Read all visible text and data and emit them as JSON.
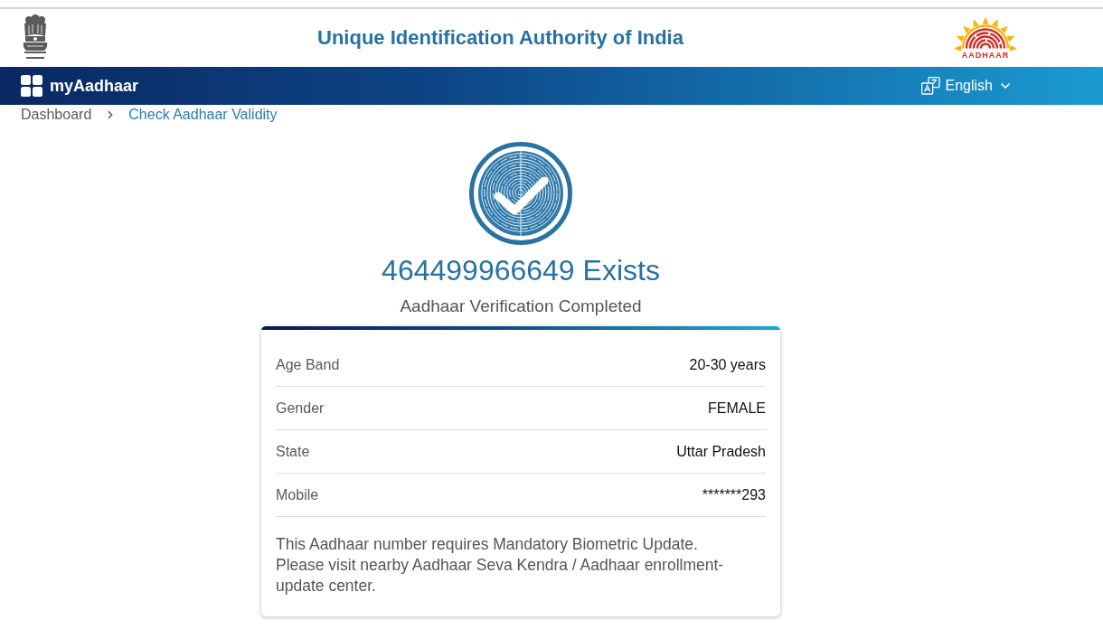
{
  "header": {
    "title": "Unique Identification Authority of India",
    "logo_text": "AADHAAR"
  },
  "nav": {
    "brand": "myAadhaar",
    "language": "English"
  },
  "breadcrumb": [
    {
      "label": "Dashboard",
      "current": false
    },
    {
      "label": "Check Aadhaar Validity",
      "current": true
    }
  ],
  "result": {
    "title": "464499966649 Exists",
    "subtitle": "Aadhaar Verification Completed"
  },
  "details": [
    {
      "label": "Age Band",
      "value": "20-30 years"
    },
    {
      "label": "Gender",
      "value": "FEMALE"
    },
    {
      "label": "State",
      "value": "Uttar Pradesh"
    },
    {
      "label": "Mobile",
      "value": "*******293"
    }
  ],
  "note": "This Aadhaar number requires Mandatory Biometric Update. Please visit nearby Aadhaar Seva Kendra / Aadhaar enrollment-update center."
}
